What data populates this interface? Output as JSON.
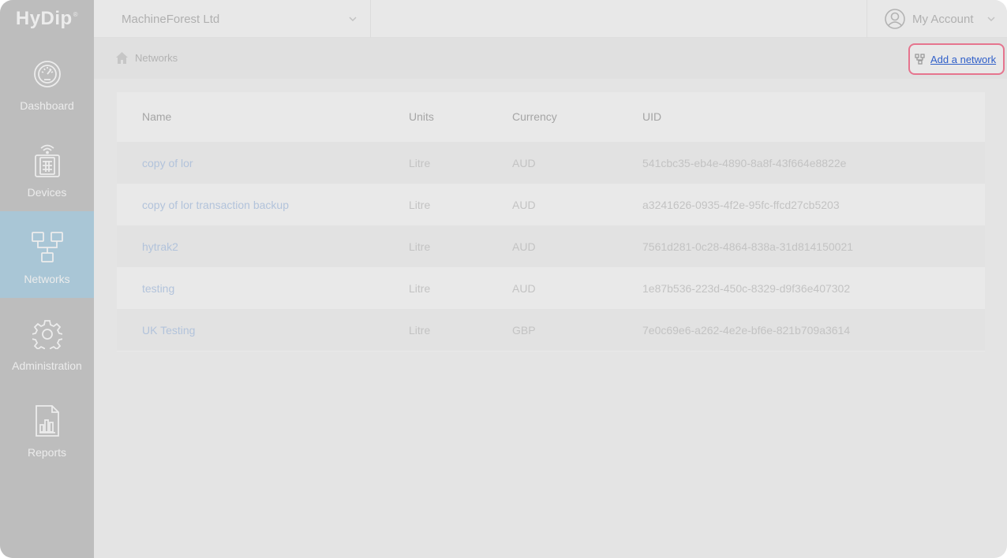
{
  "app": {
    "logo_text": "HyDip",
    "logo_mark": "®"
  },
  "sidebar": {
    "items": [
      {
        "label": "Dashboard",
        "icon": "gauge-icon",
        "active": false
      },
      {
        "label": "Devices",
        "icon": "device-icon",
        "active": false
      },
      {
        "label": "Networks",
        "icon": "network-icon",
        "active": true
      },
      {
        "label": "Administration",
        "icon": "gear-icon",
        "active": false
      },
      {
        "label": "Reports",
        "icon": "report-icon",
        "active": false
      }
    ]
  },
  "topbar": {
    "organization": "MachineForest Ltd",
    "account_label": "My Account"
  },
  "breadcrumb": {
    "current": "Networks"
  },
  "actions": {
    "add_network_label": "Add a network"
  },
  "table": {
    "columns": [
      "Name",
      "Units",
      "Currency",
      "UID"
    ],
    "rows": [
      {
        "name": "copy of lor",
        "units": "Litre",
        "currency": "AUD",
        "uid": "541cbc35-eb4e-4890-8a8f-43f664e8822e"
      },
      {
        "name": "copy of lor transaction backup",
        "units": "Litre",
        "currency": "AUD",
        "uid": "a3241626-0935-4f2e-95fc-ffcd27cb5203"
      },
      {
        "name": "hytrak2",
        "units": "Litre",
        "currency": "AUD",
        "uid": "7561d281-0c28-4864-838a-31d814150021"
      },
      {
        "name": "testing",
        "units": "Litre",
        "currency": "AUD",
        "uid": "1e87b536-223d-450c-8329-d9f36e407302"
      },
      {
        "name": "UK Testing",
        "units": "Litre",
        "currency": "GBP",
        "uid": "7e0c69e6-a262-4e2e-bf6e-821b709a3614"
      }
    ]
  },
  "colors": {
    "sidebar_bg": "#bdbdbd",
    "active_nav_bg": "#a9c6d6",
    "highlight_border": "#e6748e",
    "link": "#2f5fc9"
  }
}
